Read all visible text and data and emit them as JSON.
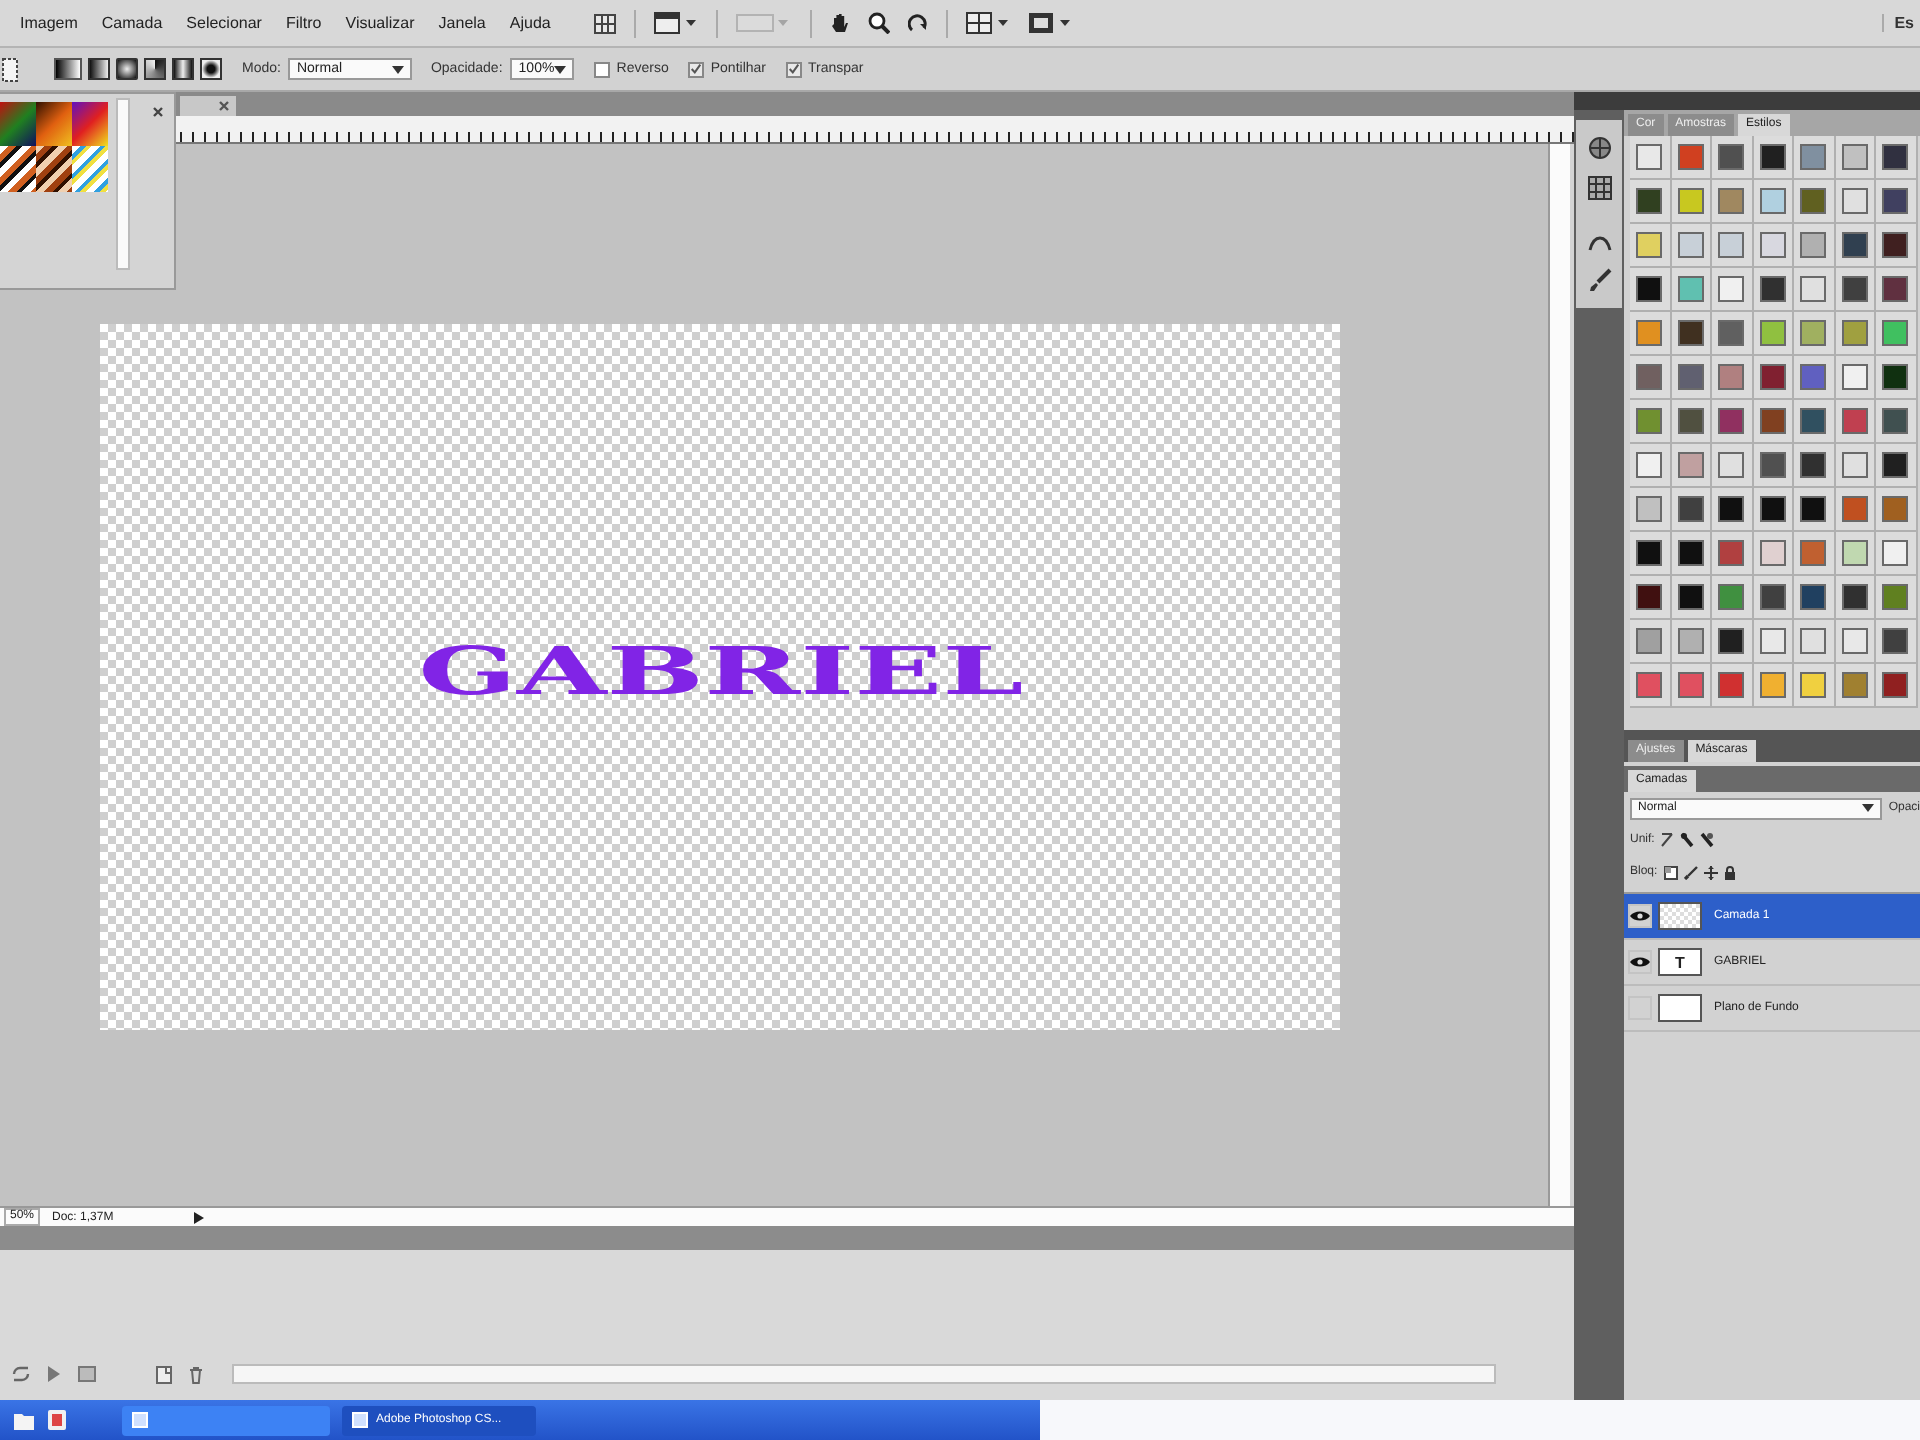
{
  "menu_bar": {
    "items": [
      "Imagem",
      "Camada",
      "Selecionar",
      "Filtro",
      "Visualizar",
      "Janela",
      "Ajuda"
    ],
    "workspace": "Es"
  },
  "options_bar": {
    "mode_label": "Modo:",
    "mode": "Normal",
    "opacity_label": "Opacidade:",
    "opacity": "100%",
    "checkboxes": [
      {
        "label": "Reverso",
        "checked": false
      },
      {
        "label": "Pontilhar",
        "checked": true
      },
      {
        "label": "Transpar",
        "checked": true
      }
    ]
  },
  "document": {
    "canvas_text": "GABRIEL",
    "status": {
      "zoom": "50%",
      "doc_info": "Doc: 1,37M"
    }
  },
  "panels": {
    "styles": {
      "tabs": [
        {
          "label": "Cor",
          "selected": false
        },
        {
          "label": "Amostras",
          "selected": false
        },
        {
          "label": "Estilos",
          "selected": true
        }
      ],
      "swatches": [
        {
          "color": "#e8e8e8"
        },
        {
          "color": "#d04020"
        },
        {
          "color": "#505050"
        },
        {
          "color": "#202020"
        },
        {
          "color": "#8090a0"
        },
        {
          "color": "#c0c0c0"
        },
        {
          "color": "#303040"
        },
        {
          "color": "#304020"
        },
        {
          "color": "#c8c820"
        },
        {
          "color": "#a08860"
        },
        {
          "color": "#b0d0e0"
        },
        {
          "color": "#606020"
        },
        {
          "color": "#e0e0e0"
        },
        {
          "color": "#404060"
        },
        {
          "color": "#e0d060"
        },
        {
          "color": "#c8d0d8"
        },
        {
          "color": "#c8d0d8"
        },
        {
          "color": "#d8d8e0"
        },
        {
          "color": "#b0b0b0"
        },
        {
          "color": "#304050"
        },
        {
          "color": "#402020"
        },
        {
          "color": "#101010"
        },
        {
          "color": "#60c0b0"
        },
        {
          "color": "#f0f0f0"
        },
        {
          "color": "#303030"
        },
        {
          "color": "#e0e0e0"
        },
        {
          "color": "#404040"
        },
        {
          "color": "#603040"
        },
        {
          "color": "#e09020"
        },
        {
          "color": "#403020"
        },
        {
          "color": "#606060"
        },
        {
          "color": "#90c040"
        },
        {
          "color": "#a0b060"
        },
        {
          "color": "#a0a040"
        },
        {
          "color": "#40c060"
        },
        {
          "color": "#706060"
        },
        {
          "color": "#606070"
        },
        {
          "color": "#b08080"
        },
        {
          "color": "#802030"
        },
        {
          "color": "#6060c0"
        },
        {
          "color": "#f0f0f0"
        },
        {
          "color": "#103010"
        },
        {
          "color": "#709030"
        },
        {
          "color": "#505040"
        },
        {
          "color": "#903060"
        },
        {
          "color": "#804020"
        },
        {
          "color": "#305060"
        },
        {
          "color": "#c04050"
        },
        {
          "color": "#405050"
        },
        {
          "color": "#f0f0f0"
        },
        {
          "color": "#c0a0a0"
        },
        {
          "color": "#e0e0e0"
        },
        {
          "color": "#505050"
        },
        {
          "color": "#303030"
        },
        {
          "color": "#e0e0e0"
        },
        {
          "color": "#202020"
        },
        {
          "color": "#c0c0c0"
        },
        {
          "color": "#404040"
        },
        {
          "color": "#101010"
        },
        {
          "color": "#101010"
        },
        {
          "color": "#101010"
        },
        {
          "color": "#c05020"
        },
        {
          "color": "#a06020"
        },
        {
          "color": "#101010"
        },
        {
          "color": "#101010"
        },
        {
          "color": "#b04040"
        },
        {
          "color": "#e0d0d0"
        },
        {
          "color": "#c06030"
        },
        {
          "color": "#c0d8b0"
        },
        {
          "color": "#f0f0f0"
        },
        {
          "color": "#401010"
        },
        {
          "color": "#101010"
        },
        {
          "color": "#409040"
        },
        {
          "color": "#404040"
        },
        {
          "color": "#204060"
        },
        {
          "color": "#303030"
        },
        {
          "color": "#608020"
        },
        {
          "color": "#a0a0a0"
        },
        {
          "color": "#b0b0b0"
        },
        {
          "color": "#202020"
        },
        {
          "color": "#e8e8e8"
        },
        {
          "color": "#e0e0e0"
        },
        {
          "color": "#e8e8e8"
        },
        {
          "color": "#404040"
        },
        {
          "color": "#e05060"
        },
        {
          "color": "#e05060"
        },
        {
          "color": "#d03030"
        },
        {
          "color": "#f0b030"
        },
        {
          "color": "#f0d040"
        },
        {
          "color": "#a08030"
        },
        {
          "color": "#902020"
        }
      ]
    },
    "adjustments": {
      "tabs": [
        {
          "label": "Ajustes",
          "selected": false
        },
        {
          "label": "Máscaras",
          "selected": true
        }
      ]
    },
    "layers": {
      "tabs": [
        {
          "label": "Camadas",
          "selected": true
        }
      ],
      "blend_mode": "Normal",
      "opacity_label": "Opaci",
      "unify_label": "Unif:",
      "lock_label": "Bloq:",
      "items": [
        {
          "name": "Camada 1",
          "kind": "pixel",
          "selected": true,
          "visible": true
        },
        {
          "name": "GABRIEL",
          "kind": "text",
          "thumbnail": "T",
          "selected": false,
          "visible": true
        },
        {
          "name": "Plano de Fundo",
          "kind": "background",
          "selected": false,
          "visible": false
        }
      ]
    }
  },
  "taskbar": {
    "tasks": [
      {
        "selected": false
      },
      {
        "label": "Adobe Photoshop CS...",
        "selected": true
      }
    ]
  }
}
